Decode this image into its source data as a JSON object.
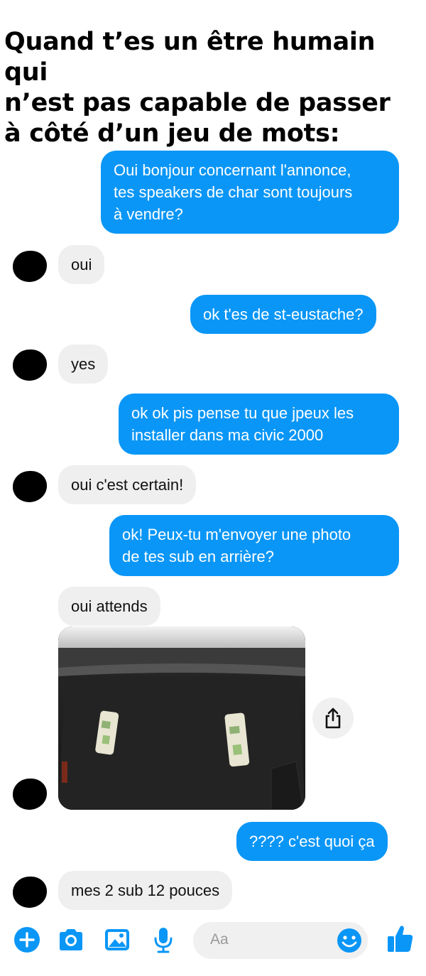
{
  "meme": {
    "caption_line1": "Quand t’es un être humain qui",
    "caption_line2": "n’est pas capable de passer",
    "caption_line3": "à côté d’un jeu de mots:"
  },
  "messages": {
    "m1_line1": "Oui bonjour concernant l'annonce,",
    "m1_line2": "tes speakers de char sont toujours",
    "m1_line3": "à vendre?",
    "m2": "oui",
    "m3": "ok t'es de st-eustache?",
    "m4": "yes",
    "m5_line1": "ok ok pis pense tu que jpeux les",
    "m5_line2": "installer dans ma civic 2000",
    "m6": "oui c'est certain!",
    "m7_line1": "ok! Peux-tu m'envoyer une photo",
    "m7_line2": "de tes sub en arrière?",
    "m8": "oui attends",
    "m9": "???? c'est quoi ça",
    "m10": "mes 2 sub 12 pouces"
  },
  "composer": {
    "placeholder": "Aa",
    "icons": [
      "plus-icon",
      "camera-icon",
      "image-icon",
      "microphone-icon",
      "emoji-icon",
      "thumbs-up-icon"
    ]
  },
  "colors": {
    "outgoing_bubble": "#0a96f6",
    "incoming_bubble": "#efefef",
    "accent": "#0a96f6"
  }
}
